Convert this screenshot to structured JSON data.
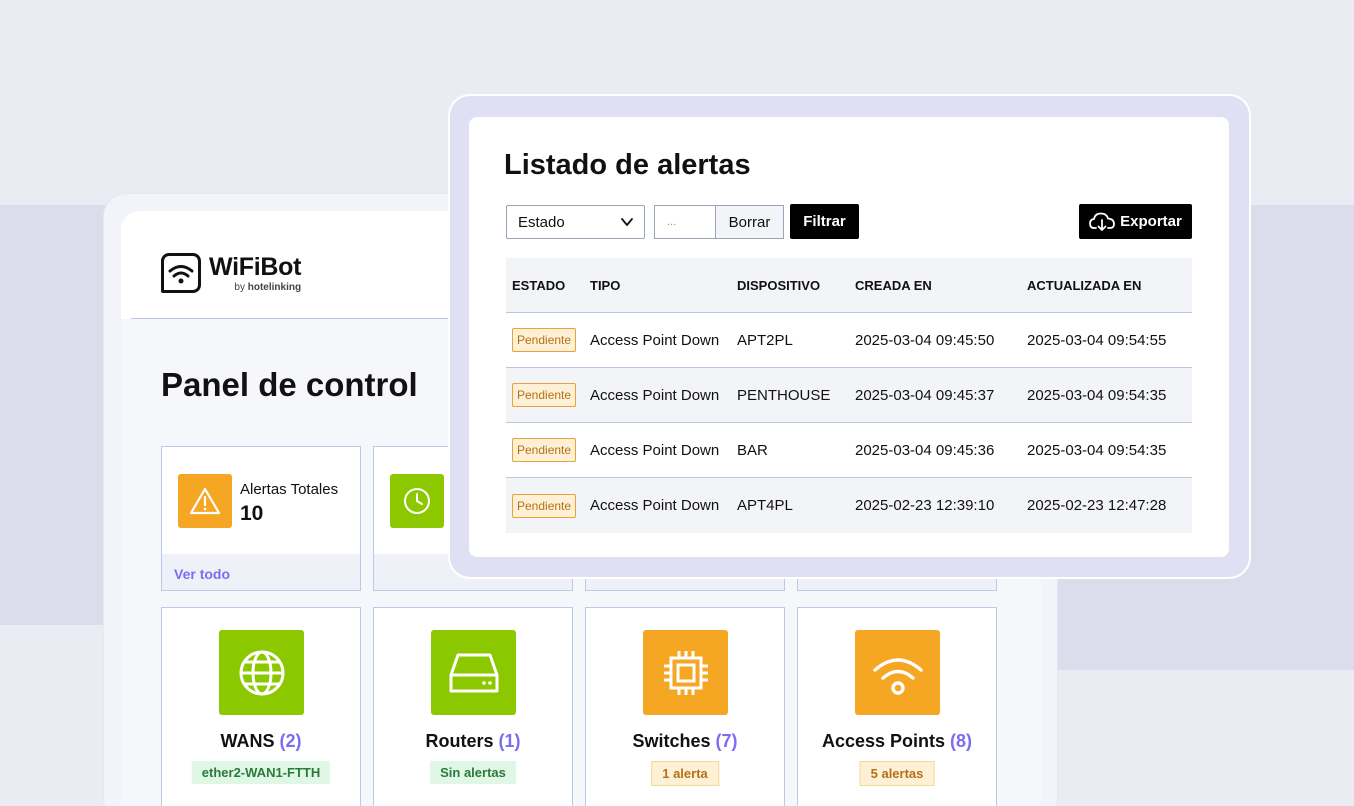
{
  "dashboard": {
    "brand": {
      "name": "WiFiBot",
      "by_prefix": "by",
      "by_name": "hotelinking"
    },
    "title": "Panel de control",
    "stats": [
      {
        "label": "Alertas Totales",
        "value": "10",
        "link": "Ver todo",
        "color": "#f5a623",
        "icon": "warning-icon"
      },
      {
        "label": "",
        "value": "",
        "link": "",
        "color": "#8cc800",
        "icon": "clock-icon"
      }
    ],
    "devices": [
      {
        "name": "WANS",
        "count": "(2)",
        "badge": "ether2-WAN1-FTTH",
        "color": "#8cc800",
        "badge_kind": "green",
        "icon": "globe-icon"
      },
      {
        "name": "Routers",
        "count": "(1)",
        "badge": "Sin alertas",
        "color": "#8cc800",
        "badge_kind": "green",
        "icon": "router-icon"
      },
      {
        "name": "Switches",
        "count": "(7)",
        "badge": "1 alerta",
        "color": "#f5a623",
        "badge_kind": "amber",
        "icon": "chip-icon"
      },
      {
        "name": "Access Points",
        "count": "(8)",
        "badge": "5 alertas",
        "color": "#f5a623",
        "badge_kind": "amber",
        "icon": "wifi-icon"
      }
    ]
  },
  "alerts": {
    "title": "Listado de alertas",
    "filter_select": "Estado",
    "date_placeholder": "...",
    "clear_button": "Borrar",
    "filter_button": "Filtrar",
    "export_button": "Exportar",
    "columns": [
      "ESTADO",
      "TIPO",
      "DISPOSITIVO",
      "CREADA EN",
      "ACTUALIZADA EN"
    ],
    "rows": [
      {
        "estado": "Pendiente",
        "tipo": "Access Point Down",
        "dispositivo": "APT2PL",
        "creada": "2025-03-04 09:45:50",
        "actualizada": "2025-03-04 09:54:55"
      },
      {
        "estado": "Pendiente",
        "tipo": "Access Point Down",
        "dispositivo": "PENTHOUSE",
        "creada": "2025-03-04 09:45:37",
        "actualizada": "2025-03-04 09:54:35"
      },
      {
        "estado": "Pendiente",
        "tipo": "Access Point Down",
        "dispositivo": "BAR",
        "creada": "2025-03-04 09:45:36",
        "actualizada": "2025-03-04 09:54:35"
      },
      {
        "estado": "Pendiente",
        "tipo": "Access Point Down",
        "dispositivo": "APT4PL",
        "creada": "2025-02-23 12:39:10",
        "actualizada": "2025-02-23 12:47:28"
      }
    ]
  }
}
